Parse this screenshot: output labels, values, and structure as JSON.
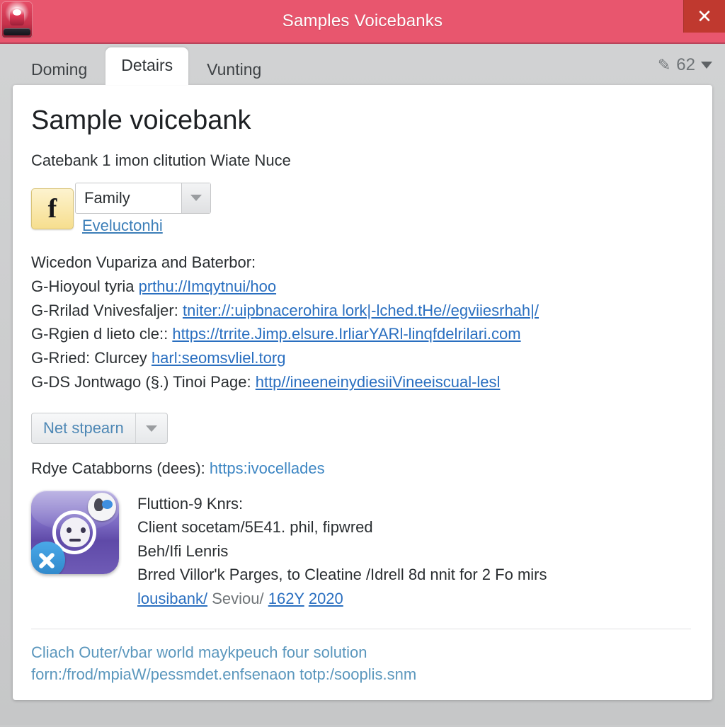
{
  "window": {
    "title": "Samples Voicebanks",
    "close_label": "✕",
    "app_icon": "voicebank-app-icon"
  },
  "tabs": [
    {
      "label": "Doming",
      "active": false
    },
    {
      "label": "Detairs",
      "active": true
    },
    {
      "label": "Vunting",
      "active": false
    }
  ],
  "tabstrip_right": {
    "value": "62",
    "pen_icon": "pen-icon",
    "caret_icon": "chevron-down-icon"
  },
  "details": {
    "title": "Sample voicebank",
    "subtitle": "Catebank 1 imon clitution Wiate Nuce",
    "family": {
      "icon_glyph": "f",
      "selected": "Family",
      "link": "Eveluctonhi"
    },
    "links_heading": "Wicedon Vupariza and Baterbor:",
    "link_lines": [
      {
        "label": "G-Hioyoul tyria",
        "url": "prthu://Imqytnui/hoo"
      },
      {
        "label": "G-Rrilad Vnivesfaljer:",
        "url": "tniter://:uipbnacerohira lork|-lched.tHe//egviiesrhah|/"
      },
      {
        "label": "G-Rgien d lieto cle::",
        "url": "https://trrite.Jimp.elsure.IrliarYARl-linqfdelrilari.com"
      },
      {
        "label": "G-Rried: Clurcey",
        "url": "harl:seomsvliel.torg"
      },
      {
        "label": "G-DS Jontwago (§.) Tinoi Page:",
        "url": "http//ineeneinydiesiiVineeiscual-lesl"
      }
    ],
    "stream_select": {
      "value": "Net stpearn",
      "caret_icon": "chevron-down-icon"
    },
    "catabborns": {
      "label": "Rdye Catabborns (dees):",
      "link": "https:ivocellades"
    },
    "media": {
      "thumb_icon": "voicebank-thumbnail-icon",
      "lines": [
        {
          "text": "Fluttion-9 Knrs:"
        },
        {
          "text": "Client socetam/5E41. phil, fipwred"
        },
        {
          "text": "Beh/Ifi Lenris"
        },
        {
          "text": "Brred Villor'k Parges, to Cleatine /Idrell 8d nnit for 2 Fo mirs"
        }
      ],
      "credit": {
        "link1": "lousibank/",
        "muted": "Seviou/",
        "link2": "162Y",
        "link3": "2020"
      }
    },
    "footer_note": [
      "Cliach Outer/vbar world maykpeuch four solution",
      "forn:/frod/mpiaW/pessmdet.enfsenaon totp:/sooplis.snm"
    ]
  },
  "colors": {
    "titlebar": "#e8566e",
    "close": "#c0392f",
    "link": "#2a6fc0",
    "accent_yellow": "#f6de8e",
    "thumb_purple": "#7d6cc4"
  }
}
